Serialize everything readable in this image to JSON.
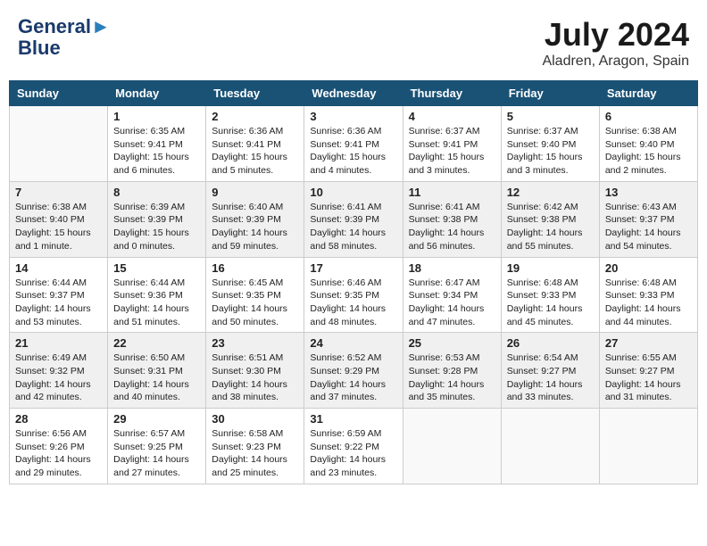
{
  "header": {
    "logo_line1": "General",
    "logo_line2": "Blue",
    "month": "July 2024",
    "location": "Aladren, Aragon, Spain"
  },
  "days_of_week": [
    "Sunday",
    "Monday",
    "Tuesday",
    "Wednesday",
    "Thursday",
    "Friday",
    "Saturday"
  ],
  "weeks": [
    [
      {
        "day": "",
        "info": ""
      },
      {
        "day": "1",
        "info": "Sunrise: 6:35 AM\nSunset: 9:41 PM\nDaylight: 15 hours\nand 6 minutes."
      },
      {
        "day": "2",
        "info": "Sunrise: 6:36 AM\nSunset: 9:41 PM\nDaylight: 15 hours\nand 5 minutes."
      },
      {
        "day": "3",
        "info": "Sunrise: 6:36 AM\nSunset: 9:41 PM\nDaylight: 15 hours\nand 4 minutes."
      },
      {
        "day": "4",
        "info": "Sunrise: 6:37 AM\nSunset: 9:41 PM\nDaylight: 15 hours\nand 3 minutes."
      },
      {
        "day": "5",
        "info": "Sunrise: 6:37 AM\nSunset: 9:40 PM\nDaylight: 15 hours\nand 3 minutes."
      },
      {
        "day": "6",
        "info": "Sunrise: 6:38 AM\nSunset: 9:40 PM\nDaylight: 15 hours\nand 2 minutes."
      }
    ],
    [
      {
        "day": "7",
        "info": "Sunrise: 6:38 AM\nSunset: 9:40 PM\nDaylight: 15 hours\nand 1 minute."
      },
      {
        "day": "8",
        "info": "Sunrise: 6:39 AM\nSunset: 9:39 PM\nDaylight: 15 hours\nand 0 minutes."
      },
      {
        "day": "9",
        "info": "Sunrise: 6:40 AM\nSunset: 9:39 PM\nDaylight: 14 hours\nand 59 minutes."
      },
      {
        "day": "10",
        "info": "Sunrise: 6:41 AM\nSunset: 9:39 PM\nDaylight: 14 hours\nand 58 minutes."
      },
      {
        "day": "11",
        "info": "Sunrise: 6:41 AM\nSunset: 9:38 PM\nDaylight: 14 hours\nand 56 minutes."
      },
      {
        "day": "12",
        "info": "Sunrise: 6:42 AM\nSunset: 9:38 PM\nDaylight: 14 hours\nand 55 minutes."
      },
      {
        "day": "13",
        "info": "Sunrise: 6:43 AM\nSunset: 9:37 PM\nDaylight: 14 hours\nand 54 minutes."
      }
    ],
    [
      {
        "day": "14",
        "info": "Sunrise: 6:44 AM\nSunset: 9:37 PM\nDaylight: 14 hours\nand 53 minutes."
      },
      {
        "day": "15",
        "info": "Sunrise: 6:44 AM\nSunset: 9:36 PM\nDaylight: 14 hours\nand 51 minutes."
      },
      {
        "day": "16",
        "info": "Sunrise: 6:45 AM\nSunset: 9:35 PM\nDaylight: 14 hours\nand 50 minutes."
      },
      {
        "day": "17",
        "info": "Sunrise: 6:46 AM\nSunset: 9:35 PM\nDaylight: 14 hours\nand 48 minutes."
      },
      {
        "day": "18",
        "info": "Sunrise: 6:47 AM\nSunset: 9:34 PM\nDaylight: 14 hours\nand 47 minutes."
      },
      {
        "day": "19",
        "info": "Sunrise: 6:48 AM\nSunset: 9:33 PM\nDaylight: 14 hours\nand 45 minutes."
      },
      {
        "day": "20",
        "info": "Sunrise: 6:48 AM\nSunset: 9:33 PM\nDaylight: 14 hours\nand 44 minutes."
      }
    ],
    [
      {
        "day": "21",
        "info": "Sunrise: 6:49 AM\nSunset: 9:32 PM\nDaylight: 14 hours\nand 42 minutes."
      },
      {
        "day": "22",
        "info": "Sunrise: 6:50 AM\nSunset: 9:31 PM\nDaylight: 14 hours\nand 40 minutes."
      },
      {
        "day": "23",
        "info": "Sunrise: 6:51 AM\nSunset: 9:30 PM\nDaylight: 14 hours\nand 38 minutes."
      },
      {
        "day": "24",
        "info": "Sunrise: 6:52 AM\nSunset: 9:29 PM\nDaylight: 14 hours\nand 37 minutes."
      },
      {
        "day": "25",
        "info": "Sunrise: 6:53 AM\nSunset: 9:28 PM\nDaylight: 14 hours\nand 35 minutes."
      },
      {
        "day": "26",
        "info": "Sunrise: 6:54 AM\nSunset: 9:27 PM\nDaylight: 14 hours\nand 33 minutes."
      },
      {
        "day": "27",
        "info": "Sunrise: 6:55 AM\nSunset: 9:27 PM\nDaylight: 14 hours\nand 31 minutes."
      }
    ],
    [
      {
        "day": "28",
        "info": "Sunrise: 6:56 AM\nSunset: 9:26 PM\nDaylight: 14 hours\nand 29 minutes."
      },
      {
        "day": "29",
        "info": "Sunrise: 6:57 AM\nSunset: 9:25 PM\nDaylight: 14 hours\nand 27 minutes."
      },
      {
        "day": "30",
        "info": "Sunrise: 6:58 AM\nSunset: 9:23 PM\nDaylight: 14 hours\nand 25 minutes."
      },
      {
        "day": "31",
        "info": "Sunrise: 6:59 AM\nSunset: 9:22 PM\nDaylight: 14 hours\nand 23 minutes."
      },
      {
        "day": "",
        "info": ""
      },
      {
        "day": "",
        "info": ""
      },
      {
        "day": "",
        "info": ""
      }
    ]
  ]
}
